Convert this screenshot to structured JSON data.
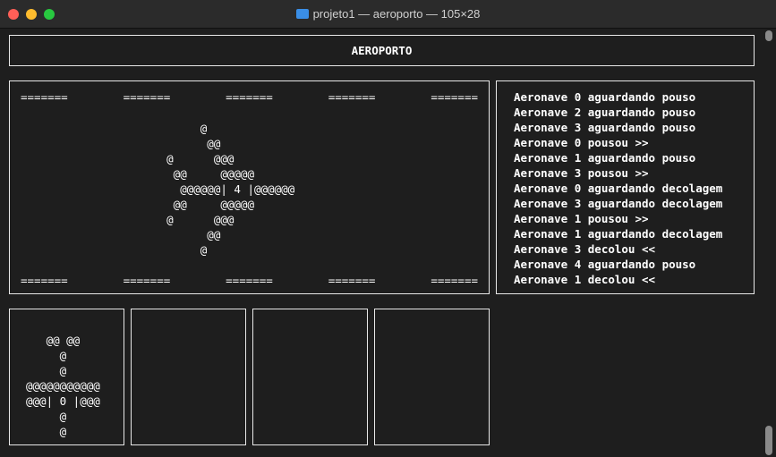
{
  "window": {
    "title": "projeto1 — aeroporto — 105×28",
    "colors": {
      "background": "#1e1e1e",
      "text": "#ffffff",
      "border": "#e8e8e8"
    }
  },
  "header": {
    "title": "AEROPORTO"
  },
  "runway": {
    "edge_marks": [
      "=======",
      "=======",
      "=======",
      "=======",
      "======="
    ],
    "plane_art": "           @\n            @@\n      @      @@@\n       @@     @@@@@\n        @@@@@@| 4 |@@@@@@\n       @@     @@@@@\n      @      @@@\n            @@\n           @"
  },
  "log": {
    "lines": [
      "Aeronave 0 aguardando pouso",
      "Aeronave 2 aguardando pouso",
      "Aeronave 3 aguardando pouso",
      "Aeronave 0 pousou >>",
      "Aeronave 1 aguardando pouso",
      "Aeronave 3 pousou >>",
      "Aeronave 0 aguardando decolagem",
      "Aeronave 3 aguardando decolagem",
      "Aeronave 1 pousou >>",
      "Aeronave 1 aguardando decolagem",
      "Aeronave 3 decolou <<",
      "Aeronave 4 aguardando pouso",
      "Aeronave 1 decolou <<"
    ]
  },
  "gates": [
    {
      "plane_art": "   @@ @@\n     @\n     @\n@@@@@@@@@@@\n@@@| 0 |@@@\n     @\n     @"
    },
    {
      "plane_art": ""
    },
    {
      "plane_art": ""
    },
    {
      "plane_art": ""
    }
  ]
}
